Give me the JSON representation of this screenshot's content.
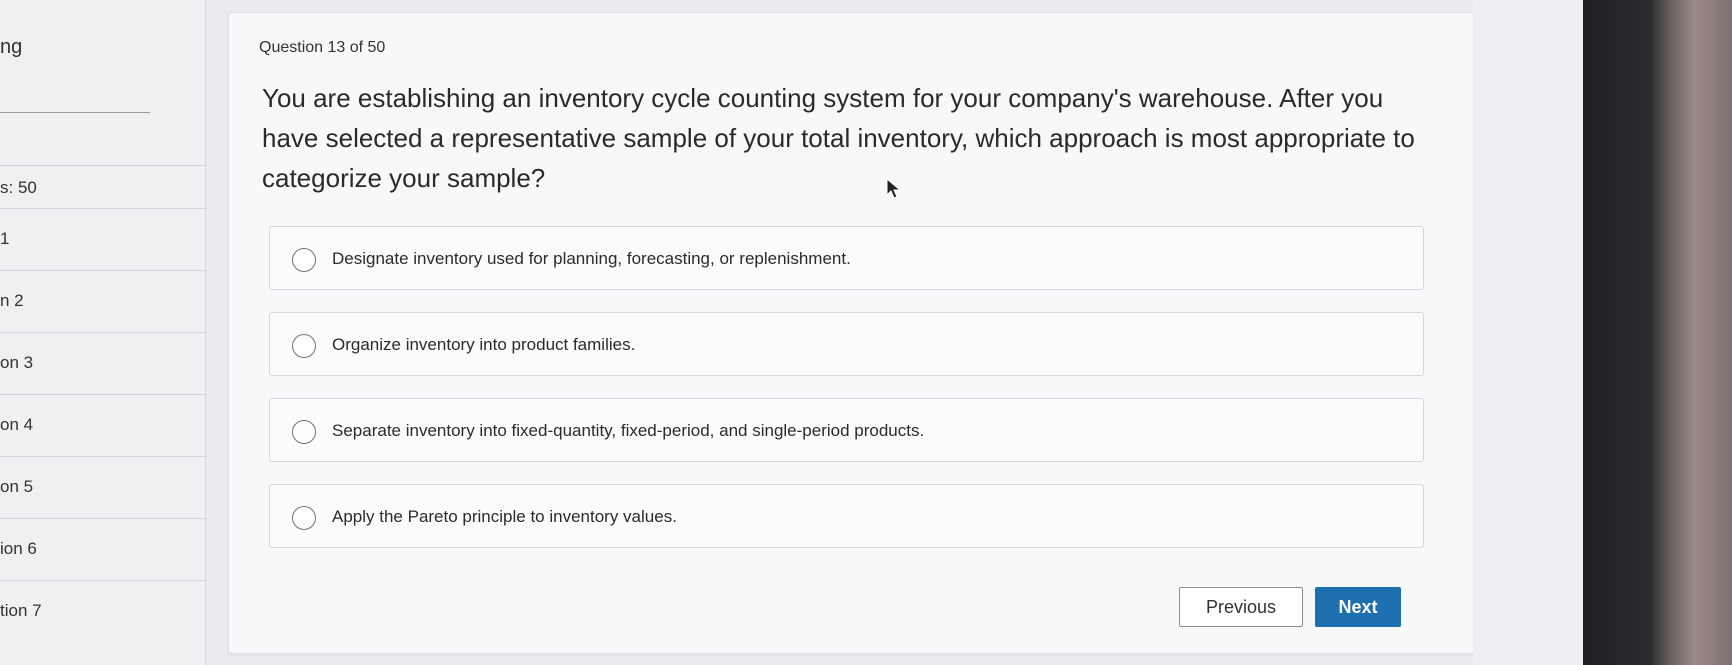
{
  "sidebar": {
    "title": "ng",
    "questions_label": "s: 50",
    "items": [
      {
        "label": "1"
      },
      {
        "label": "n 2"
      },
      {
        "label": "on 3"
      },
      {
        "label": "on 4"
      },
      {
        "label": "on 5"
      },
      {
        "label": "ion 6"
      },
      {
        "label": "tion 7"
      }
    ]
  },
  "question": {
    "counter": "Question 13 of 50",
    "text": "You are establishing an inventory cycle counting system for your company's warehouse. After you have selected a representative sample of your total inventory, which approach is most appropriate to categorize your sample?",
    "options": [
      {
        "label": "Designate inventory used for planning, forecasting, or replenishment."
      },
      {
        "label": "Organize inventory into product families."
      },
      {
        "label": "Separate inventory into fixed-quantity, fixed-period, and single-period products."
      },
      {
        "label": "Apply the Pareto principle to inventory values."
      }
    ]
  },
  "nav": {
    "previous_label": "Previous",
    "next_label": "Next"
  },
  "colors": {
    "accent": "#1d6fb0",
    "background": "#e9ebee",
    "card": "#f7f8f9"
  }
}
